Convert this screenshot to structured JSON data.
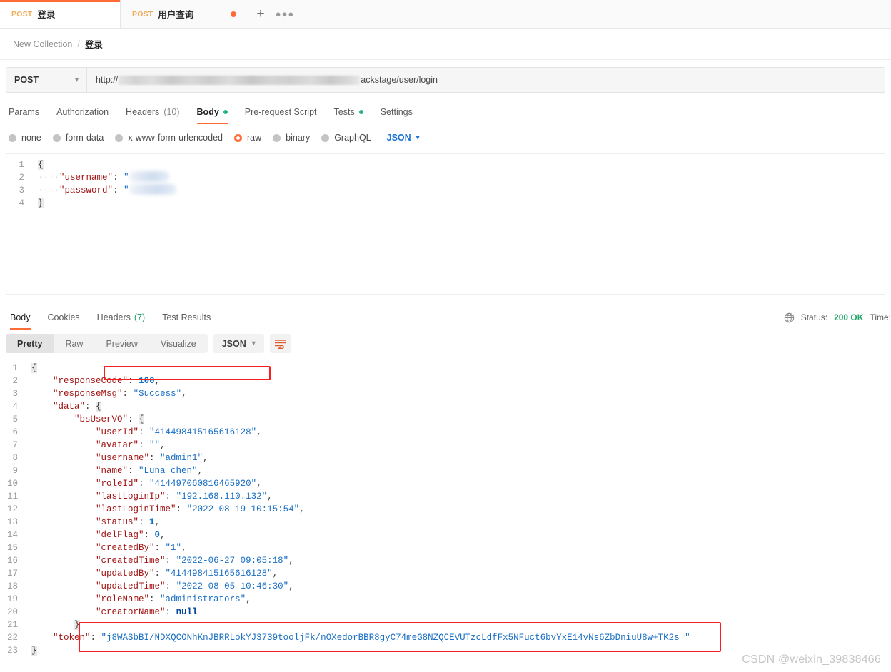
{
  "tabs": [
    {
      "method": "POST",
      "name": "登录",
      "active": true,
      "unsaved": false
    },
    {
      "method": "POST",
      "name": "用户查询",
      "active": false,
      "unsaved": true
    }
  ],
  "tabbar": {
    "add_label": "+",
    "more_label": "000"
  },
  "breadcrumb": {
    "collection": "New Collection",
    "separator": "/",
    "current": "登录"
  },
  "request": {
    "method": "POST",
    "url_prefix": "http://",
    "url_suffix": "ackstage/user/login",
    "tabs": [
      {
        "label": "Params",
        "dot": false,
        "count": "",
        "active": false
      },
      {
        "label": "Authorization",
        "dot": false,
        "count": "",
        "active": false
      },
      {
        "label": "Headers",
        "dot": false,
        "count": "(10)",
        "active": false
      },
      {
        "label": "Body",
        "dot": true,
        "count": "",
        "active": true
      },
      {
        "label": "Pre-request Script",
        "dot": false,
        "count": "",
        "active": false
      },
      {
        "label": "Tests",
        "dot": true,
        "count": "",
        "active": false
      },
      {
        "label": "Settings",
        "dot": false,
        "count": "",
        "active": false
      }
    ],
    "body_types": [
      {
        "label": "none",
        "selected": false
      },
      {
        "label": "form-data",
        "selected": false
      },
      {
        "label": "x-www-form-urlencoded",
        "selected": false
      },
      {
        "label": "raw",
        "selected": true
      },
      {
        "label": "binary",
        "selected": false
      },
      {
        "label": "GraphQL",
        "selected": false
      }
    ],
    "format": "JSON",
    "body_lines": [
      {
        "n": "1",
        "kind": "open-brace"
      },
      {
        "n": "2",
        "kind": "redacted",
        "key": "username"
      },
      {
        "n": "3",
        "kind": "redacted",
        "key": "password"
      },
      {
        "n": "4",
        "kind": "close-brace"
      }
    ]
  },
  "response": {
    "tabs": [
      {
        "label": "Body",
        "count": "",
        "active": true
      },
      {
        "label": "Cookies",
        "count": "",
        "active": false
      },
      {
        "label": "Headers",
        "count": "(7)",
        "active": false
      },
      {
        "label": "Test Results",
        "count": "",
        "active": false
      }
    ],
    "status_label": "Status:",
    "status_value": "200 OK",
    "time_label": "Time:",
    "view_modes": [
      {
        "label": "Pretty",
        "active": true
      },
      {
        "label": "Raw",
        "active": false
      },
      {
        "label": "Preview",
        "active": false
      },
      {
        "label": "Visualize",
        "active": false
      }
    ],
    "format": "JSON",
    "lines": [
      {
        "n": "1",
        "indent": 0,
        "text": "{",
        "type": "brace"
      },
      {
        "n": "2",
        "indent": 1,
        "key": "responseCode",
        "value": "100",
        "vtype": "num",
        "comma": true
      },
      {
        "n": "3",
        "indent": 1,
        "key": "responseMsg",
        "value": "Success",
        "vtype": "str",
        "comma": true
      },
      {
        "n": "4",
        "indent": 1,
        "key": "data",
        "value": "{",
        "vtype": "brace",
        "comma": false
      },
      {
        "n": "5",
        "indent": 2,
        "key": "bsUserVO",
        "value": "{",
        "vtype": "brace",
        "comma": false
      },
      {
        "n": "6",
        "indent": 3,
        "key": "userId",
        "value": "414498415165616128",
        "vtype": "str",
        "comma": true,
        "highlight": true
      },
      {
        "n": "7",
        "indent": 3,
        "key": "avatar",
        "value": "",
        "vtype": "str",
        "comma": true
      },
      {
        "n": "8",
        "indent": 3,
        "key": "username",
        "value": "admin1",
        "vtype": "str",
        "comma": true
      },
      {
        "n": "9",
        "indent": 3,
        "key": "name",
        "value": "Luna chen",
        "vtype": "str",
        "comma": true
      },
      {
        "n": "10",
        "indent": 3,
        "key": "roleId",
        "value": "414497060816465920",
        "vtype": "str",
        "comma": true
      },
      {
        "n": "11",
        "indent": 3,
        "key": "lastLoginIp",
        "value": "192.168.110.132",
        "vtype": "str",
        "comma": true
      },
      {
        "n": "12",
        "indent": 3,
        "key": "lastLoginTime",
        "value": "2022-08-19 10:15:54",
        "vtype": "str",
        "comma": true
      },
      {
        "n": "13",
        "indent": 3,
        "key": "status",
        "value": "1",
        "vtype": "num",
        "comma": true
      },
      {
        "n": "14",
        "indent": 3,
        "key": "delFlag",
        "value": "0",
        "vtype": "num",
        "comma": true
      },
      {
        "n": "15",
        "indent": 3,
        "key": "createdBy",
        "value": "1",
        "vtype": "str",
        "comma": true
      },
      {
        "n": "16",
        "indent": 3,
        "key": "createdTime",
        "value": "2022-06-27 09:05:18",
        "vtype": "str",
        "comma": true
      },
      {
        "n": "17",
        "indent": 3,
        "key": "updatedBy",
        "value": "414498415165616128",
        "vtype": "str",
        "comma": true
      },
      {
        "n": "18",
        "indent": 3,
        "key": "updatedTime",
        "value": "2022-08-05 10:46:30",
        "vtype": "str",
        "comma": true
      },
      {
        "n": "19",
        "indent": 3,
        "key": "roleName",
        "value": "administrators",
        "vtype": "str",
        "comma": true
      },
      {
        "n": "20",
        "indent": 3,
        "key": "creatorName",
        "value": "null",
        "vtype": "null",
        "comma": false
      },
      {
        "n": "21",
        "indent": 2,
        "text": "}",
        "type": "brace"
      },
      {
        "n": "22",
        "indent": 1,
        "key": "token",
        "value": "j8WASbBI/NDXQCONhKnJBRRLokYJ3739tooljFk/nOXedorBBR8gyC74meG8NZQCEVUTzcLdfFx5NFuct6bvYxE14vNs6ZbDniuU8w+TK2s=",
        "vtype": "str",
        "comma": false,
        "highlight": true,
        "underline": true
      },
      {
        "n": "23",
        "indent": 0,
        "text": "}",
        "type": "brace"
      }
    ]
  },
  "watermark": "CSDN @weixin_39838466",
  "colors": {
    "accent": "#ff6c37",
    "status_ok": "#24a36b",
    "highlight_box": "#fb1e1e",
    "json_link": "#1c72d4"
  }
}
